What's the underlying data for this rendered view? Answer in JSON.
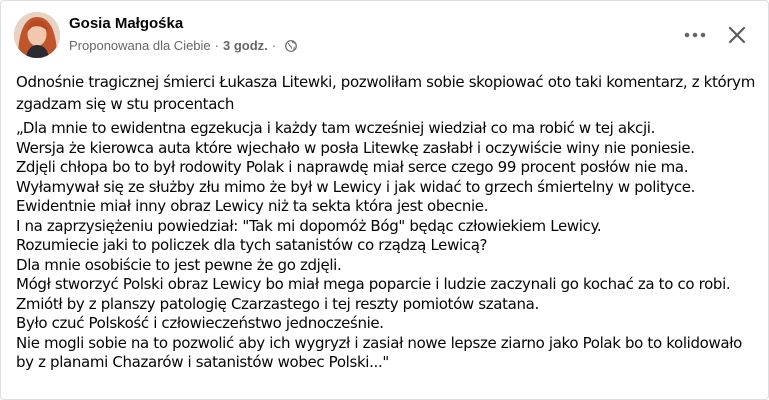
{
  "post": {
    "author": "Gosia Małgośka",
    "suggested": "Proponowana dla Ciebie",
    "separator": "·",
    "time": "3 godz.",
    "privacy_icon": "globe-icon",
    "more_icon": "more-horizontal-icon",
    "close_icon": "close-icon",
    "intro": "Odnośnie tragicznej śmierci Łukasza Litewki, pozwoliłam sobie skopiować oto taki komentarz, z którym zgadzam się w stu procentach",
    "quote_lines": [
      "„Dla mnie to ewidentna egzekucja i każdy tam wcześniej wiedział co ma robić w tej akcji.",
      "Wersja że kierowca auta które wjechało w posła Litewkę zasłabł i oczywiście winy nie poniesie.",
      "Zdjęli chłopa bo to był rodowity Polak i naprawdę miał serce czego 99 procent posłów nie ma.",
      "Wyłamywał się ze służby złu mimo że był w Lewicy i jak widać to grzech śmiertelny w polityce.",
      "Ewidentnie miał inny obraz Lewicy niż ta sekta która jest obecnie.",
      "I na zaprzysiężeniu powiedział: \"Tak mi dopomóż Bóg\" będąc człowiekiem Lewicy.",
      "Rozumiecie jaki to policzek dla tych satanistów co rządzą Lewicą?",
      "Dla mnie osobiście to jest pewne że go zdjęli.",
      "Mógł stworzyć Polski obraz Lewicy bo miał mega poparcie i ludzie zaczynali go kochać za to co robi.",
      "Zmiótł by z planszy patologię Czarzastego i tej reszty pomiotów szatana.",
      "Było czuć Polskość i człowieczeństwo jednocześnie.",
      "Nie mogli sobie na to pozwolić aby ich wygryzł i zasiał nowe lepsze ziarno jako Polak bo to kolidowało by z planami Chazarów i satanistów wobec Polski...\""
    ]
  },
  "colors": {
    "text": "#050505",
    "secondary": "#65676b",
    "icon": "#65676b",
    "border": "#dadde1"
  }
}
